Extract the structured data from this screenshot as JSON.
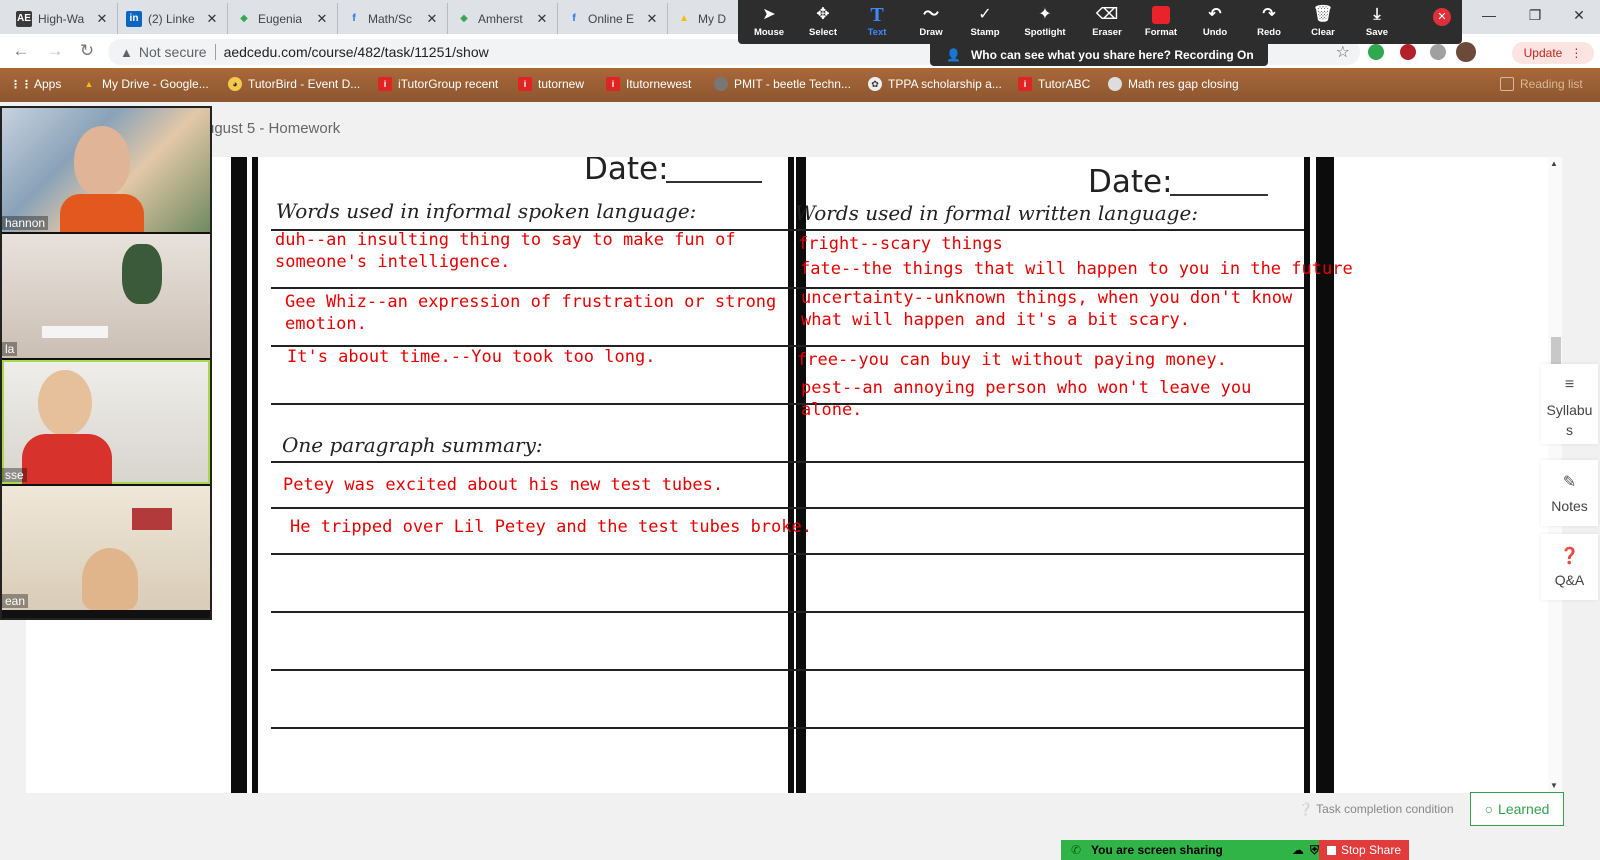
{
  "browser": {
    "tabs": [
      {
        "title": "High-Wa",
        "fav": "AE",
        "fav_color": "#3a3a3a"
      },
      {
        "title": "(2) Linke",
        "fav": "in",
        "fav_color": "#0a66c2"
      },
      {
        "title": "Eugenia",
        "fav": "◆",
        "fav_color": "#34a853"
      },
      {
        "title": "Math/Sc",
        "fav": "f",
        "fav_color": "#1a73e8"
      },
      {
        "title": "Amherst",
        "fav": "◆",
        "fav_color": "#34a853"
      },
      {
        "title": "Online E",
        "fav": "f",
        "fav_color": "#1a73e8"
      },
      {
        "title": "My D",
        "fav": "▲",
        "fav_color": "#fbbc04"
      }
    ],
    "address": {
      "not_secure": "Not secure",
      "url": "aedcedu.com/course/482/task/11251/show"
    },
    "update_label": "Update",
    "bookmarks": [
      {
        "label": "Apps",
        "icon": "apps-grid"
      },
      {
        "label": "My Drive - Google...",
        "icon": "drive"
      },
      {
        "label": "TutorBird - Event D...",
        "icon": "tutorbird"
      },
      {
        "label": "iTutorGroup recent",
        "icon": "itutor"
      },
      {
        "label": "tutornew",
        "icon": "itutor"
      },
      {
        "label": "Itutornewest",
        "icon": "itutor"
      },
      {
        "label": "PMIT - beetle Techn...",
        "icon": "globe"
      },
      {
        "label": "TPPA scholarship a...",
        "icon": "tppa"
      },
      {
        "label": "TutorABC",
        "icon": "itutor"
      },
      {
        "label": "Math res gap closing",
        "icon": "globe"
      },
      {
        "label": "Reading list",
        "icon": "reading-list"
      }
    ]
  },
  "annotate": {
    "tools": [
      {
        "label": "Mouse",
        "icon": "arrow-cursor"
      },
      {
        "label": "Select",
        "icon": "move"
      },
      {
        "label": "Text",
        "icon": "text-T"
      },
      {
        "label": "Draw",
        "icon": "squiggle"
      },
      {
        "label": "Stamp",
        "icon": "check"
      },
      {
        "label": "Spotlight",
        "icon": "wand"
      },
      {
        "label": "Eraser",
        "icon": "eraser"
      },
      {
        "label": "Format",
        "icon": "red-square"
      },
      {
        "label": "Undo",
        "icon": "undo"
      },
      {
        "label": "Redo",
        "icon": "redo"
      },
      {
        "label": "Clear",
        "icon": "trash"
      },
      {
        "label": "Save",
        "icon": "save"
      }
    ],
    "active_tool": "Text",
    "recording_banner": "Who can see what you share here? Recording On"
  },
  "page": {
    "breadcrumb": "ugust 5 - Homework",
    "notebook": {
      "left": {
        "date_label": "Date:",
        "heading": "Words used in informal spoken language:",
        "entries": [
          "duh--an insulting thing to say to make fun of\nsomeone's intelligence.",
          "Gee Whiz--an expression of frustration or strong\nemotion.",
          "It's about time.--You took too long."
        ],
        "summary_heading": "One paragraph summary:",
        "summary": [
          "Petey was excited about his new test tubes.",
          "He tripped over Lil Petey and the test tubes broke."
        ]
      },
      "right": {
        "date_label": "Date:",
        "heading": "Words used in formal written language:",
        "entries": [
          "fright--scary things",
          "fate--the things that will happen to you in the future",
          "uncertainty--unknown things, when you don't know\nwhat will happen and it's a bit scary.",
          "free--you can buy it without paying money.",
          "pest--an annoying person who won't leave you\nalone."
        ]
      }
    },
    "side_panel": [
      {
        "label": "Syllabu\ns",
        "icon": "list-icon"
      },
      {
        "label": "Notes",
        "icon": "pencil-icon"
      },
      {
        "label": "Q&A",
        "icon": "question-icon"
      }
    ],
    "task_condition": "Task completion condition",
    "learned_label": "Learned"
  },
  "zoom": {
    "participants": [
      {
        "name": "hannon"
      },
      {
        "name": "la"
      },
      {
        "name": "sse"
      },
      {
        "name": "ean"
      }
    ],
    "share_status": "You are screen sharing",
    "stop_share": "Stop Share"
  }
}
